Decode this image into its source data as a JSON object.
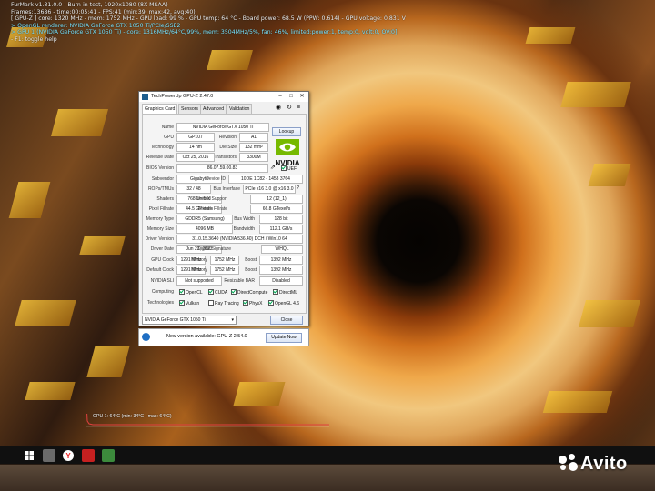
{
  "osd": {
    "line1": "FurMark v1.31.0.0 - Burn-in test, 1920x1080 (8X MSAA)",
    "line2": "Frames:13686 - time:00:05:41 - FPS:41 (min:39, max:42, avg:40)",
    "line3": "[ GPU-Z ] core: 1320 MHz - mem: 1752 MHz - GPU load: 99 % - GPU temp: 64 °C - Board power: 68.5 W (PPW: 0.614) - GPU voltage: 0.831 V",
    "line4": "> OpenGL renderer: NVIDIA GeForce GTX 1050 Ti/PCIe/SSE2",
    "line5": "> GPU 1 (NVIDIA GeForce GTX 1050 Ti) - core: 1316MHz/64°C/99%, mem: 3504MHz/5%, fan: 46%, limited:power:1, temp:0, volt:0, OV:0]",
    "line6": "- F1: toggle help"
  },
  "gpuz": {
    "title": "TechPowerUp GPU-Z 2.47.0",
    "minimize": "–",
    "maximize": "□",
    "close_x": "✕",
    "tabs": [
      "Graphics Card",
      "Sensors",
      "Advanced",
      "Validation"
    ],
    "tool_icons": {
      "camera": "◉",
      "refresh": "↻",
      "menu": "≡"
    },
    "labels": {
      "name": "Name",
      "gpu": "GPU",
      "revision": "Revision",
      "technology": "Technology",
      "die_size": "Die Size",
      "release_date": "Release Date",
      "transistors": "Transistors",
      "bios_version": "BIOS Version",
      "uefi": "UEFI",
      "subvendor": "Subvendor",
      "device_id": "Device ID",
      "rops_tmus": "ROPs/TMUs",
      "bus_interface": "Bus Interface",
      "shaders": "Shaders",
      "directx_support": "DirectX Support",
      "pixel_fillrate": "Pixel Fillrate",
      "texture_fillrate": "Texture Fillrate",
      "memory_type": "Memory Type",
      "bus_width": "Bus Width",
      "memory_size": "Memory Size",
      "bandwidth": "Bandwidth",
      "driver_version": "Driver Version",
      "driver_date": "Driver Date",
      "digital_signature": "Digital Signature",
      "gpu_clock": "GPU Clock",
      "memory": "Memory",
      "boost": "Boost",
      "default_clock": "Default Clock",
      "nvidia_sli": "NVIDIA SLI",
      "resizable_bar": "Resizable BAR",
      "computing": "Computing",
      "technologies": "Technologies"
    },
    "values": {
      "name": "NVIDIA GeForce GTX 1050 Ti",
      "lookup": "Lookup",
      "gpu": "GP107",
      "revision": "A1",
      "technology": "14 nm",
      "die_size": "132 mm²",
      "release_date": "Oct 25, 2016",
      "transistors": "3300M",
      "bios_version": "86.07.59.00.83",
      "subvendor": "Gigabyte",
      "device_id": "10DE 1C82 - 1458 3764",
      "rops_tmus": "32 / 48",
      "bus_interface": "PCIe x16 3.0 @ x16 3.0",
      "bus_help": "?",
      "shaders": "768 Unified",
      "directx_support": "12 (12_1)",
      "pixel_fillrate": "44.5 GPixel/s",
      "texture_fillrate": "66.8 GTexel/s",
      "memory_type": "GDDR5 (Samsung)",
      "bus_width": "128 bit",
      "memory_size": "4096 MB",
      "bandwidth": "112.1 GB/s",
      "driver_version": "31.0.15.3640 (NVIDIA 536.40) DCH / Win10 64",
      "driver_date": "Jun 23, 2023",
      "digital_signature": "WHQL",
      "gpu_clock": "1291 MHz",
      "gpu_memory": "1752 MHz",
      "gpu_boost": "1392 MHz",
      "default_clock": "1291 MHz",
      "default_memory": "1752 MHz",
      "default_boost": "1392 MHz",
      "nvidia_sli": "Not supported",
      "resizable_bar": "Disabled"
    },
    "computing": [
      {
        "label": "OpenCL",
        "checked": true
      },
      {
        "label": "CUDA",
        "checked": true
      },
      {
        "label": "DirectCompute",
        "checked": true
      },
      {
        "label": "DirectML",
        "checked": true
      }
    ],
    "technologies": [
      {
        "label": "Vulkan",
        "checked": true
      },
      {
        "label": "Ray Tracing",
        "checked": false
      },
      {
        "label": "PhysX",
        "checked": true
      },
      {
        "label": "OpenGL 4.6",
        "checked": true
      }
    ],
    "selected_gpu": "NVIDIA GeForce GTX 1050 Ti",
    "close_button": "Close",
    "nvidia_logo": "NVIDIA"
  },
  "notice": {
    "message": "New version available: GPU-Z 2.54.0",
    "button": "Update Now",
    "icon": "i"
  },
  "graph": {
    "label": "GPU 1: 64°C (min: 34°C - max: 64°C)"
  },
  "watermark": {
    "text": "Avito"
  },
  "colors": {
    "accent": "#1f6fc4",
    "nvidia_green": "#76b900",
    "osd_cyan": "#7fe7ff"
  }
}
